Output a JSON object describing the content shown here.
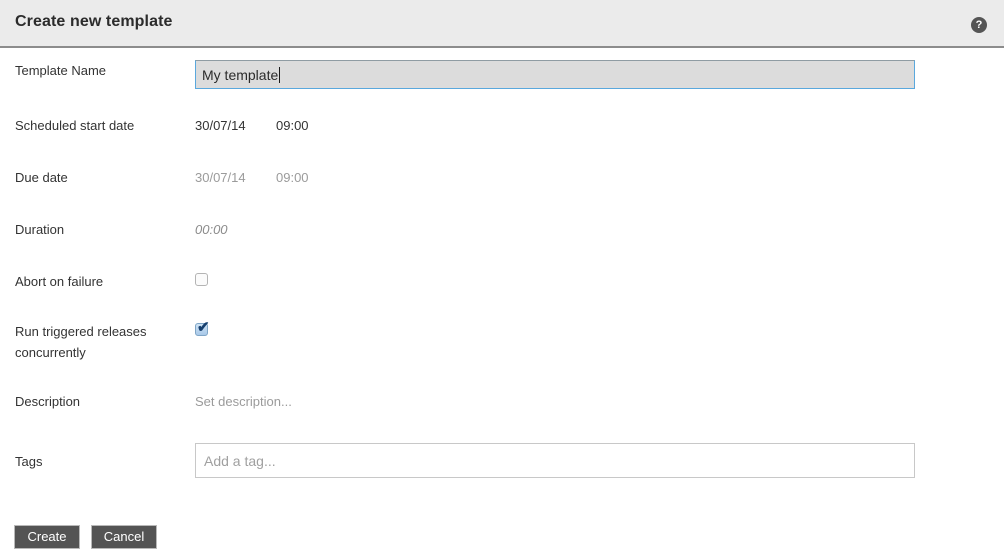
{
  "header": {
    "title": "Create new template",
    "help_icon": "help-circle-icon",
    "help_glyph": "?"
  },
  "form": {
    "fields": [
      {
        "key": "template_name",
        "label": "Template Name",
        "value": "My template",
        "type": "text-input",
        "focused": true
      },
      {
        "key": "scheduled_start_date",
        "label": "Scheduled start date",
        "date": "30/07/14",
        "time": "09:00",
        "type": "datetime",
        "muted": false
      },
      {
        "key": "due_date",
        "label": "Due date",
        "date": "30/07/14",
        "time": "09:00",
        "type": "datetime",
        "muted": true
      },
      {
        "key": "duration",
        "label": "Duration",
        "value": "00:00",
        "type": "duration"
      },
      {
        "key": "abort_on_failure",
        "label": "Abort on failure",
        "type": "checkbox",
        "checked": false
      },
      {
        "key": "run_triggered_releases_concurrently",
        "label_line1": "Run triggered releases",
        "label_line2": "concurrently",
        "type": "checkbox",
        "checked": true,
        "check_glyph": "✔"
      },
      {
        "key": "description",
        "label": "Description",
        "placeholder": "Set description...",
        "type": "placeholder-text"
      },
      {
        "key": "tags",
        "label": "Tags",
        "placeholder": "Add a tag...",
        "type": "tag-input"
      }
    ]
  },
  "footer": {
    "create_label": "Create",
    "cancel_label": "Cancel"
  },
  "colors": {
    "header_bg": "#ebebeb",
    "focus_border": "#5aa8dd",
    "input_disabled_bg": "#dcdcdc",
    "button_bg": "#545454",
    "muted_text": "#9b9b9b"
  }
}
